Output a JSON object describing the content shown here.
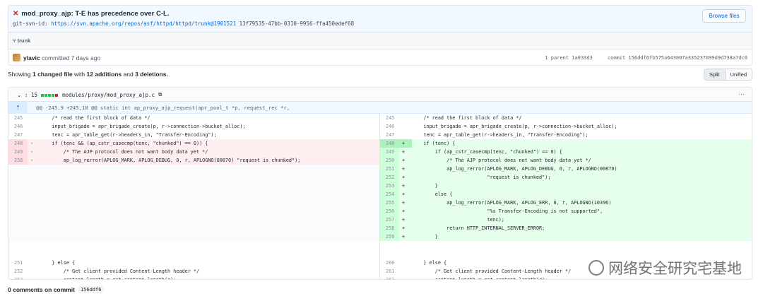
{
  "commit": {
    "title": "mod_proxy_ajp: T-E has precedence over C-L.",
    "svn_prefix": "git-svn-id:",
    "svn_url": "https://svn.apache.org/repos/asf/httpd/httpd/trunk@1901521",
    "svn_uuid": "13f79535-47bb-0310-9956-ffa450edef68",
    "browse_label": "Browse files",
    "branch": "trunk",
    "author": "ylavic",
    "committed": "committed 7 days ago",
    "parent_label": "1 parent",
    "parent_sha": "1a033d3",
    "commit_label": "commit",
    "commit_sha": "156ddf6fb575a643007a335237899d9d738a7dc0"
  },
  "summary": {
    "prefix": "Showing",
    "changed": "1 changed file",
    "with": "with",
    "additions": "12 additions",
    "and": "and",
    "deletions": "3 deletions."
  },
  "view_toggle": {
    "split": "Split",
    "unified": "Unified"
  },
  "file": {
    "count": "15",
    "path": "modules/proxy/mod_proxy_ajp.c",
    "hunk": "@@ -245,9 +245,18 @@ static int ap_proxy_ajp_request(apr_pool_t *p, request_rec *r,"
  },
  "diff_left": [
    {
      "ln": "245",
      "mk": "",
      "code": "    /* read the first block of data */",
      "type": "ctx"
    },
    {
      "ln": "246",
      "mk": "",
      "code": "    input_brigade = apr_brigade_create(p, r->connection->bucket_alloc);",
      "type": "ctx"
    },
    {
      "ln": "247",
      "mk": "",
      "code": "    tenc = apr_table_get(r->headers_in, \"Transfer-Encoding\");",
      "type": "ctx"
    },
    {
      "ln": "248",
      "mk": "-",
      "code": "    if (tenc && (ap_cstr_casecmp(tenc, \"chunked\") == 0)) {",
      "type": "del"
    },
    {
      "ln": "249",
      "mk": "-",
      "code": "        /* The AJP protocol does not want body data yet */",
      "type": "del"
    },
    {
      "ln": "250",
      "mk": "-",
      "code": "        ap_log_rerror(APLOG_MARK, APLOG_DEBUG, 0, r, APLOGNO(00870) \"request is chunked\");",
      "type": "del"
    }
  ],
  "diff_right": [
    {
      "ln": "245",
      "mk": "",
      "code": "    /* read the first block of data */",
      "type": "ctx"
    },
    {
      "ln": "246",
      "mk": "",
      "code": "    input_brigade = apr_brigade_create(p, r->connection->bucket_alloc);",
      "type": "ctx"
    },
    {
      "ln": "247",
      "mk": "",
      "code": "    tenc = apr_table_get(r->headers_in, \"Transfer-Encoding\");",
      "type": "ctx"
    },
    {
      "ln": "248",
      "mk": "+",
      "code": "    if (tenc) {",
      "type": "hl"
    },
    {
      "ln": "249",
      "mk": "+",
      "code": "        if (ap_cstr_casecmp(tenc, \"chunked\") == 0) {",
      "type": "add"
    },
    {
      "ln": "250",
      "mk": "+",
      "code": "            /* The AJP protocol does not want body data yet */",
      "type": "add"
    },
    {
      "ln": "251",
      "mk": "+",
      "code": "            ap_log_rerror(APLOG_MARK, APLOG_DEBUG, 0, r, APLOGNO(00870)",
      "type": "add"
    },
    {
      "ln": "252",
      "mk": "+",
      "code": "                          \"request is chunked\");",
      "type": "add"
    },
    {
      "ln": "253",
      "mk": "+",
      "code": "        }",
      "type": "add"
    },
    {
      "ln": "254",
      "mk": "+",
      "code": "        else {",
      "type": "add"
    },
    {
      "ln": "255",
      "mk": "+",
      "code": "            ap_log_rerror(APLOG_MARK, APLOG_ERR, 0, r, APLOGNO(10396)",
      "type": "add"
    },
    {
      "ln": "256",
      "mk": "+",
      "code": "                          \"%s Transfer-Encoding is not supported\",",
      "type": "add"
    },
    {
      "ln": "257",
      "mk": "+",
      "code": "                          tenc);",
      "type": "add"
    },
    {
      "ln": "258",
      "mk": "+",
      "code": "            return HTTP_INTERNAL_SERVER_ERROR;",
      "type": "add"
    },
    {
      "ln": "259",
      "mk": "+",
      "code": "        }",
      "type": "add"
    }
  ],
  "diff_tail_left": [
    {
      "ln": "251",
      "code": "    } else {"
    },
    {
      "ln": "252",
      "code": "        /* Get client provided Content-Length header */"
    },
    {
      "ln": "253",
      "code": "        content_length = get_content_length(r);"
    }
  ],
  "diff_tail_right": [
    {
      "ln": "260",
      "code": "    } else {"
    },
    {
      "ln": "261",
      "code": "        /* Get client provided Content-Length header */"
    },
    {
      "ln": "262",
      "code": "        content_length = get_content_length(r);"
    }
  ],
  "comments": {
    "label": "0 comments on commit",
    "sha": "156ddf6"
  },
  "watermark": {
    "text": "网络安全研究宅基地"
  }
}
